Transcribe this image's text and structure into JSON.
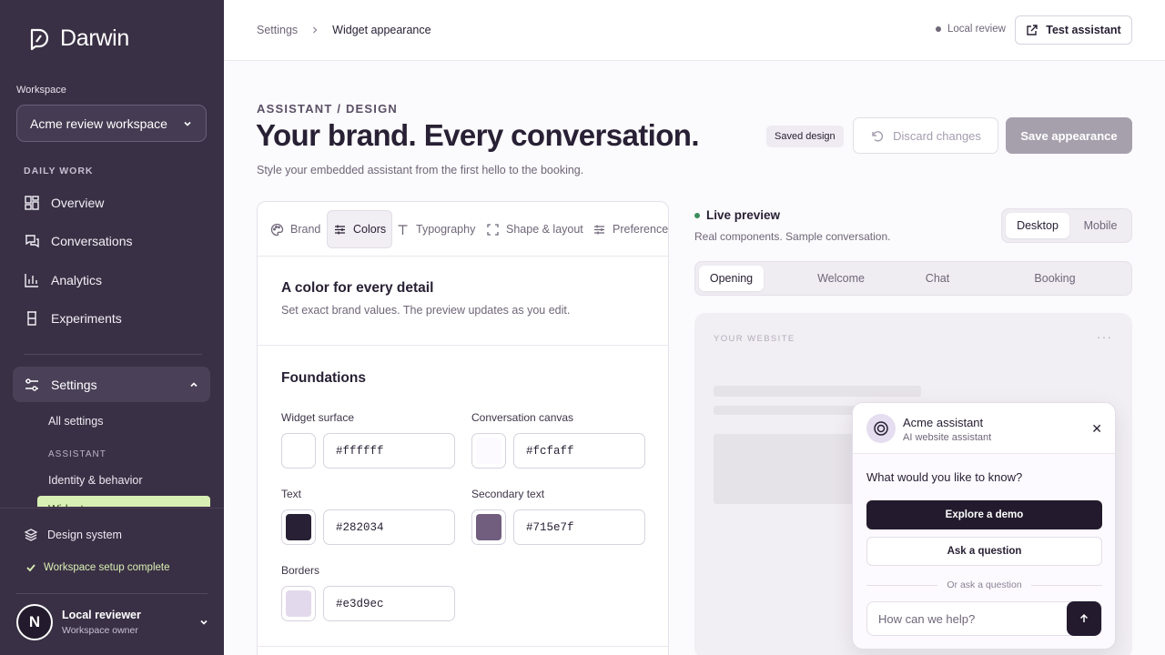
{
  "sidebar": {
    "brand": "Darwin",
    "workspace_label": "Workspace",
    "workspace_value": "Acme review workspace",
    "section_daily": "DAILY WORK",
    "nav": {
      "overview": "Overview",
      "conversations": "Conversations",
      "analytics": "Analytics",
      "experiments": "Experiments"
    },
    "settings_label": "Settings",
    "all_settings": "All settings",
    "assistant_section": "ASSISTANT",
    "identity": "Identity & behavior",
    "widget_partial": "Widget",
    "design_system": "Design system",
    "setup_complete": "Workspace setup complete",
    "user": {
      "initial": "N",
      "name": "Local reviewer",
      "role": "Workspace owner"
    }
  },
  "topbar": {
    "crumb_root": "Settings",
    "crumb_current": "Widget appearance",
    "local_review": "Local review",
    "test_button": "Test assistant"
  },
  "header": {
    "eyebrow": "ASSISTANT / DESIGN",
    "title": "Your brand. Every conversation.",
    "subtitle": "Style your embedded assistant from the first hello to the booking.",
    "saved_badge": "Saved design",
    "discard": "Discard changes",
    "save": "Save appearance"
  },
  "editor": {
    "tabs": {
      "brand": "Brand",
      "colors": "Colors",
      "typography": "Typography",
      "shape": "Shape & layout",
      "preferences": "Preferences"
    },
    "heading": "A color for every detail",
    "subheading": "Set exact brand values. The preview updates as you edit.",
    "foundations": "Foundations",
    "fields": {
      "surface": {
        "label": "Widget surface",
        "value": "#ffffff",
        "color": "#ffffff"
      },
      "canvas": {
        "label": "Conversation canvas",
        "value": "#fcfaff",
        "color": "#fcfaff"
      },
      "text": {
        "label": "Text",
        "value": "#282034",
        "color": "#282034"
      },
      "secondary": {
        "label": "Secondary text",
        "value": "#715e7f",
        "color": "#715e7f"
      },
      "borders": {
        "label": "Borders",
        "value": "#e3d9ec",
        "color": "#e3d9ec"
      }
    }
  },
  "preview": {
    "title": "Live preview",
    "subtitle": "Real components. Sample conversation.",
    "device": {
      "desktop": "Desktop",
      "mobile": "Mobile"
    },
    "steps": {
      "opening": "Opening",
      "welcome": "Welcome",
      "chat": "Chat",
      "booking": "Booking"
    },
    "site_label": "YOUR WEBSITE",
    "site_menu": "···",
    "widget": {
      "name": "Acme assistant",
      "tagline": "AI website assistant",
      "close": "✕",
      "question": "What would you like to know?",
      "primary": "Explore a demo",
      "secondary": "Ask a question",
      "or": "Or ask a question",
      "placeholder": "How can we help?"
    }
  }
}
